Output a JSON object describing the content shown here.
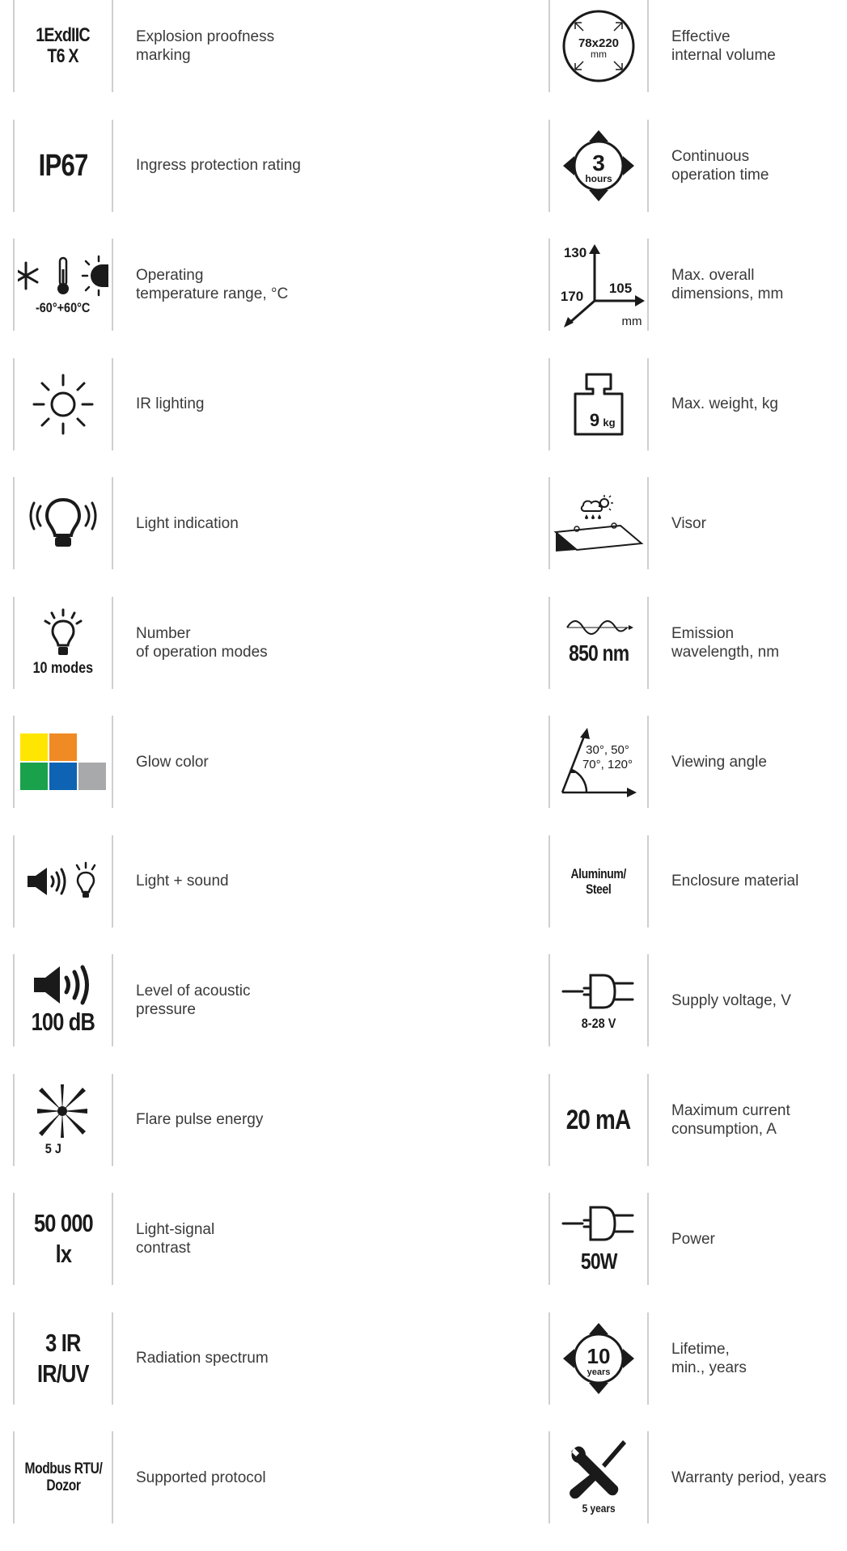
{
  "left": [
    {
      "icon": "text",
      "value": "1ExdIIC\nT6 X",
      "label": "Explosion proofness\nmarking"
    },
    {
      "icon": "text",
      "value": "IP67",
      "label": "Ingress protection rating"
    },
    {
      "icon": "temperature-icon",
      "value": "-60°+60°C",
      "label": "Operating\ntemperature range, °C"
    },
    {
      "icon": "sun-icon",
      "label": "IR lighting"
    },
    {
      "icon": "bulb-signal-icon",
      "label": "Light indication"
    },
    {
      "icon": "bulb-icon",
      "value": "10 modes",
      "label": "Number\nof operation modes"
    },
    {
      "icon": "color-swatches",
      "label": "Glow color",
      "colors": [
        "#ffe600",
        "#f08a24",
        "#1aa14b",
        "#0e63b3",
        "#a8a9ab"
      ]
    },
    {
      "icon": "speaker-bulb-icon",
      "label": "Light + sound"
    },
    {
      "icon": "speaker-icon",
      "value": "100 dB",
      "label": "Level of acoustic\npressure"
    },
    {
      "icon": "flare-icon",
      "value": "5 J",
      "label": "Flare pulse energy"
    },
    {
      "icon": "text",
      "value": "50 000\nlx",
      "label": "Light-signal\ncontrast"
    },
    {
      "icon": "text",
      "value": "3 IR\nIR/UV",
      "label": "Radiation spectrum"
    },
    {
      "icon": "text",
      "value": "Modbus RTU/\nDozor",
      "label": "Supported protocol"
    }
  ],
  "right": [
    {
      "icon": "volume-circle-icon",
      "value": "78x220",
      "unit": "mm",
      "label": "Effective\ninternal volume"
    },
    {
      "icon": "cycle-arrows-icon",
      "value": "3",
      "unit": "hours",
      "label": "Continuous\noperation time"
    },
    {
      "icon": "axes-icon",
      "dims": [
        "130",
        "170",
        "105"
      ],
      "unit": "mm",
      "label": "Max. overall\ndimensions, mm"
    },
    {
      "icon": "weight-icon",
      "value": "9",
      "unit": "kg",
      "label": "Max. weight, kg"
    },
    {
      "icon": "visor-icon",
      "label": "Visor"
    },
    {
      "icon": "wave-icon",
      "value": "850 nm",
      "label": "Emission\nwavelength, nm"
    },
    {
      "icon": "angle-icon",
      "angles": [
        "30°, 50°",
        "70°, 120°"
      ],
      "label": "Viewing angle"
    },
    {
      "icon": "text",
      "value": "Aluminum/\nSteel",
      "label": "Enclosure material"
    },
    {
      "icon": "plug-icon",
      "value": "8-28 V",
      "label": "Supply voltage, V"
    },
    {
      "icon": "text",
      "value": "20 mA",
      "label": "Maximum current\nconsumption, A"
    },
    {
      "icon": "plug-icon",
      "value": "50W",
      "label": "Power"
    },
    {
      "icon": "cycle-arrows-icon",
      "value": "10",
      "unit": "years",
      "label": "Lifetime,\nmin., years"
    },
    {
      "icon": "tools-icon",
      "value": "5 years",
      "label": "Warranty period, years"
    }
  ]
}
